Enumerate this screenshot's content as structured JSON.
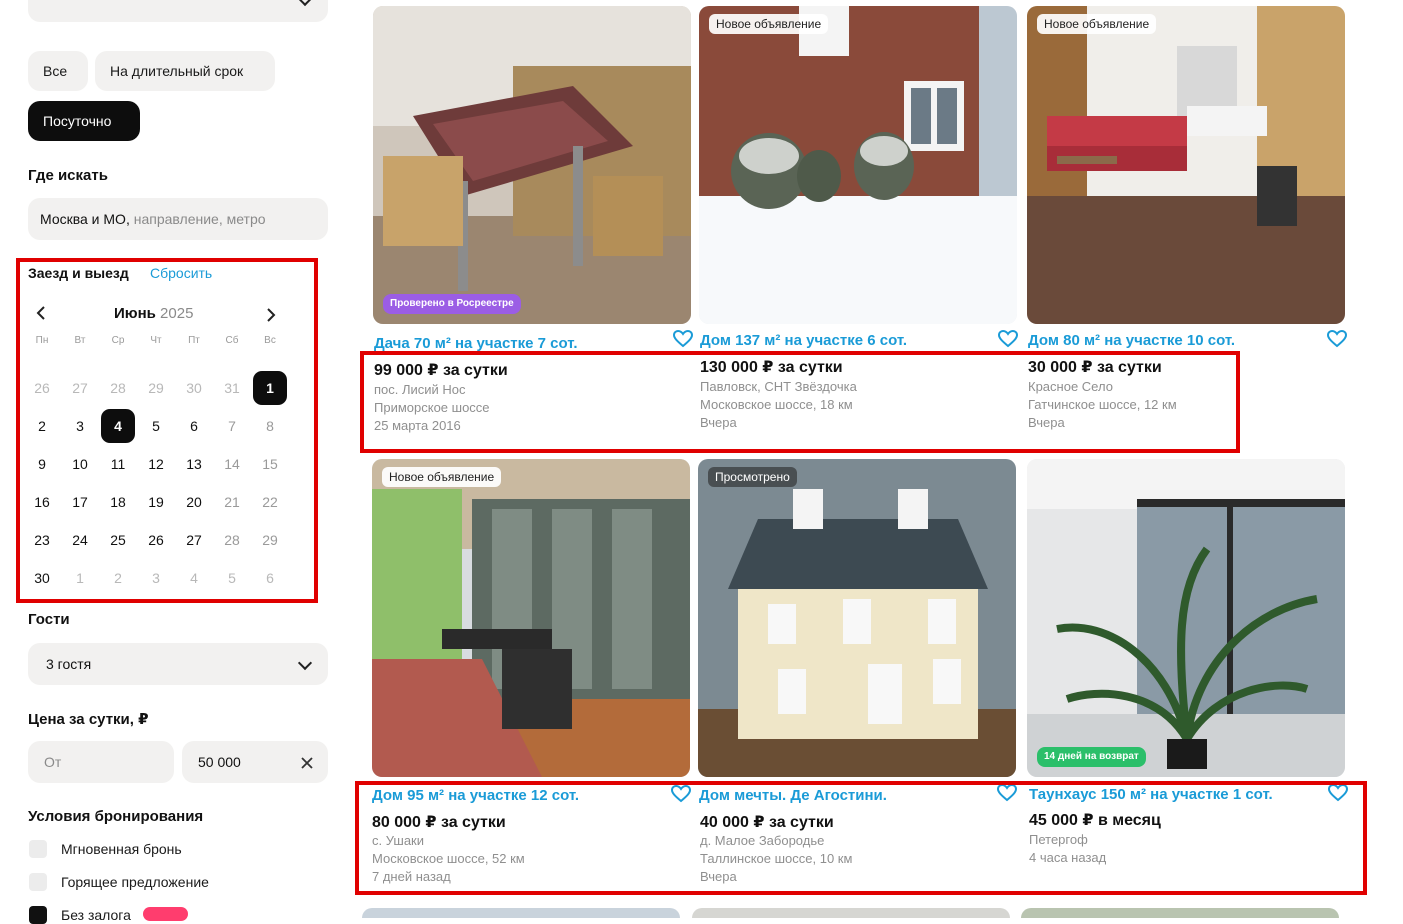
{
  "sidebar": {
    "deal_types": [
      "Все",
      "На длительный срок",
      "Посуточно"
    ],
    "where_title": "Где искать",
    "where_value": "Москва и МО,",
    "where_hint": " направление, метро",
    "dates_title": "Заезд и выезд",
    "dates_reset": "Сбросить",
    "calendar": {
      "month": "Июнь",
      "year": "2025",
      "weekdays": [
        "Пн",
        "Вт",
        "Ср",
        "Чт",
        "Пт",
        "Сб",
        "Вс"
      ],
      "weeks": [
        [
          "26",
          "27",
          "28",
          "29",
          "30",
          "31",
          "1"
        ],
        [
          "2",
          "3",
          "4",
          "5",
          "6",
          "7",
          "8"
        ],
        [
          "9",
          "10",
          "11",
          "12",
          "13",
          "14",
          "15"
        ],
        [
          "16",
          "17",
          "18",
          "19",
          "20",
          "21",
          "22"
        ],
        [
          "23",
          "24",
          "25",
          "26",
          "27",
          "28",
          "29"
        ],
        [
          "30",
          "1",
          "2",
          "3",
          "4",
          "5",
          "6"
        ]
      ],
      "selected": [
        "1",
        "4"
      ]
    },
    "guests_title": "Гости",
    "guests_value": "3 гостя",
    "price_title": "Цена за сутки, ₽",
    "price_from_placeholder": "От",
    "price_to_value": "50 000",
    "conditions_title": "Условия бронирования",
    "conditions": [
      {
        "label": "Мгновенная бронь",
        "checked": false
      },
      {
        "label": "Горящее предложение",
        "checked": false
      },
      {
        "label": "Без залога",
        "checked": true
      }
    ]
  },
  "listings": [
    {
      "title": "Дача 70 м² на участке 7 сот.",
      "price": "99 000 ₽ за сутки",
      "line1": "пос. Лисий Нос",
      "line2": "Приморское шоссе",
      "line3": "25 марта 2016",
      "badge": "",
      "bottom_badge": "Проверено в Росреестре",
      "bottom_badge_color": "#9b5de5"
    },
    {
      "title": "Дом 137 м² на участке 6 сот.",
      "price": "130 000 ₽ за сутки",
      "line1": "Павловск, СНТ Звёздочка",
      "line2": "Московское шоссе, 18 км",
      "line3": "Вчера",
      "badge": "Новое объявление",
      "bottom_badge": "",
      "bottom_badge_color": ""
    },
    {
      "title": "Дом 80 м² на участке 10 сот.",
      "price": "30 000 ₽ за сутки",
      "line1": "Красное Село",
      "line2": "Гатчинское шоссе, 12 км",
      "line3": "Вчера",
      "badge": "Новое объявление",
      "bottom_badge": "",
      "bottom_badge_color": ""
    },
    {
      "title": "Дом 95 м² на участке 12 сот.",
      "price": "80 000 ₽ за сутки",
      "line1": "с. Ушаки",
      "line2": "Московское шоссе, 52 км",
      "line3": "7 дней назад",
      "badge": "Новое объявление",
      "bottom_badge": "",
      "bottom_badge_color": ""
    },
    {
      "title": "Дом мечты. Де Агостини.",
      "price": "40 000 ₽ за сутки",
      "line1": "д. Малое Забородье",
      "line2": "Таллинское шоссе, 10 км",
      "line3": "Вчера",
      "badge": "Просмотрено",
      "bottom_badge": "",
      "bottom_badge_color": ""
    },
    {
      "title": "Таунхаус 150 м² на участке 1 сот.",
      "price": "45 000 ₽ в месяц",
      "line1": "Петергоф",
      "line2": "4 часа назад",
      "line3": "",
      "badge": "",
      "bottom_badge": "14 дней на возврат",
      "bottom_badge_color": "#2bbf6a"
    }
  ],
  "colors": {
    "link": "#1a9bd7",
    "highlight": "#e00000",
    "chip_active": "#0d0d0d",
    "chip": "#f2f1f0"
  }
}
